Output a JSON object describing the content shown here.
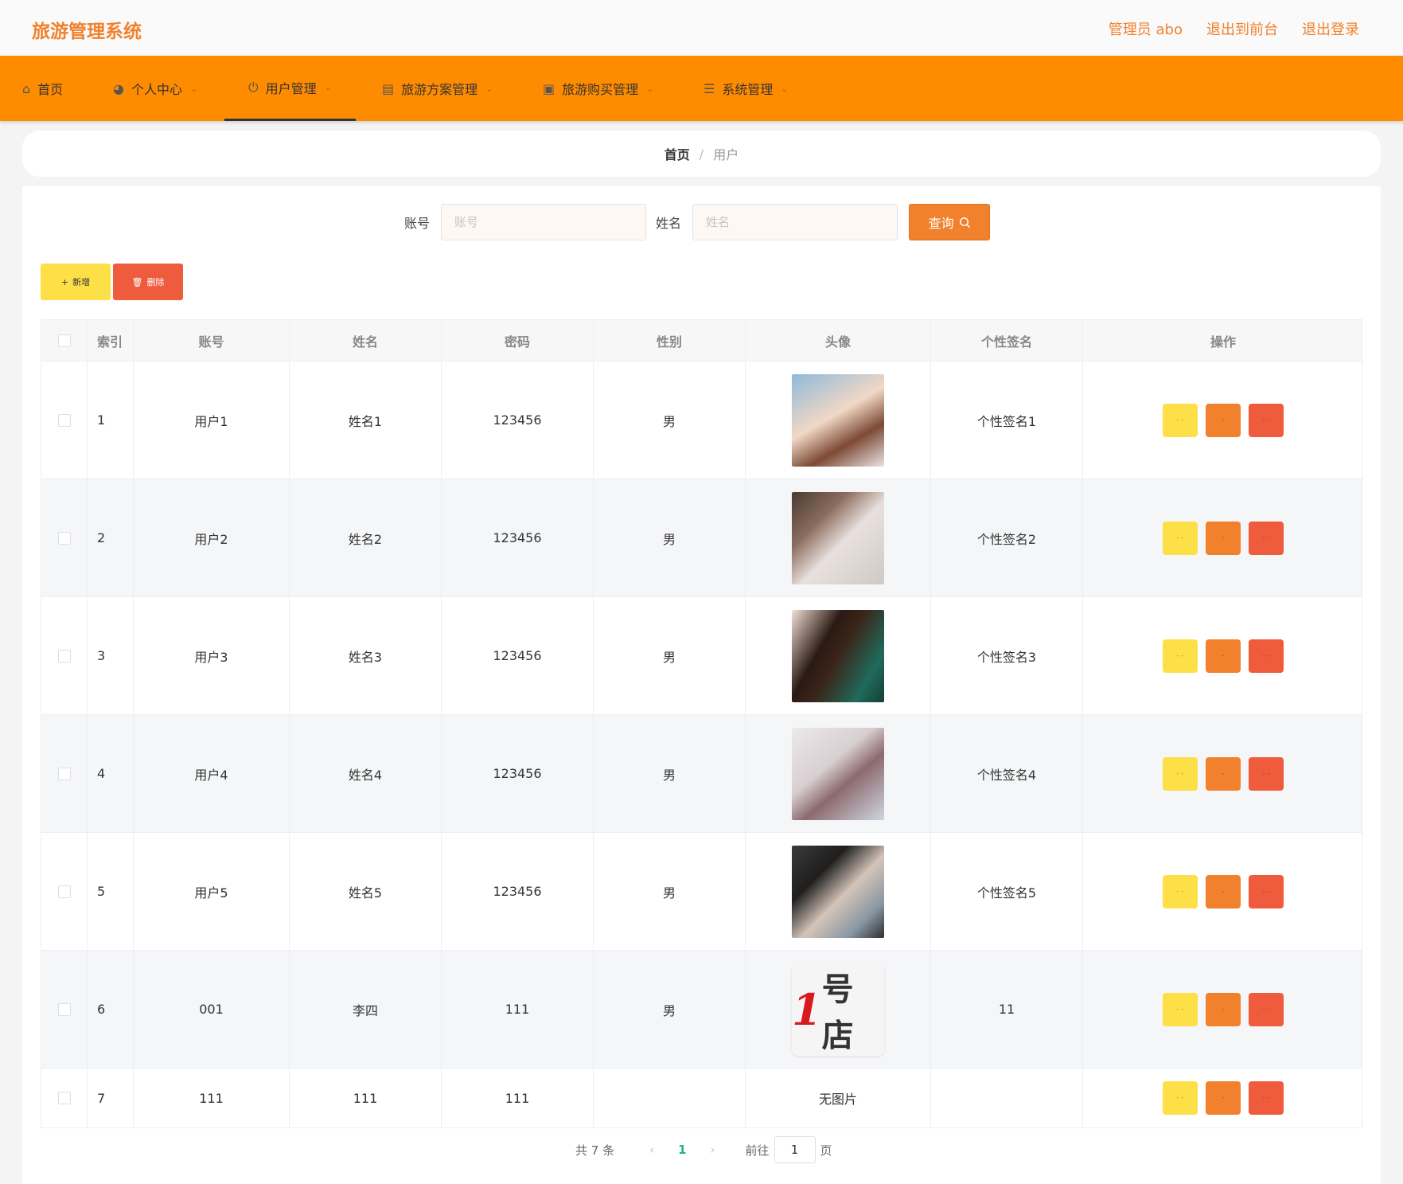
{
  "header": {
    "app_title": "旅游管理系统",
    "admin_label": "管理员 abo",
    "back_to_front": "退出到前台",
    "logout": "退出登录"
  },
  "nav": {
    "items": [
      {
        "label": "首页",
        "icon": "home-icon"
      },
      {
        "label": "个人中心",
        "icon": "user-icon"
      },
      {
        "label": "用户管理",
        "icon": "power-icon"
      },
      {
        "label": "旅游方案管理",
        "icon": "clipboard-icon"
      },
      {
        "label": "旅游购买管理",
        "icon": "briefcase-icon"
      },
      {
        "label": "系统管理",
        "icon": "sliders-icon"
      }
    ],
    "active_index": 2
  },
  "breadcrumb": {
    "home": "首页",
    "separator": "/",
    "current": "用户"
  },
  "search": {
    "account_label": "账号",
    "account_placeholder": "账号",
    "account_value": "",
    "name_label": "姓名",
    "name_placeholder": "姓名",
    "name_value": "",
    "query_button": "查询"
  },
  "actions": {
    "add": "新增",
    "delete": "删除"
  },
  "table": {
    "headers": {
      "index": "索引",
      "account": "账号",
      "name": "姓名",
      "password": "密码",
      "gender": "性别",
      "avatar": "头像",
      "signature": "个性签名",
      "ops": "操作"
    },
    "rows": [
      {
        "index": "1",
        "account": "用户1",
        "name": "姓名1",
        "password": "123456",
        "gender": "男",
        "signature": "个性签名1"
      },
      {
        "index": "2",
        "account": "用户2",
        "name": "姓名2",
        "password": "123456",
        "gender": "男",
        "signature": "个性签名2"
      },
      {
        "index": "3",
        "account": "用户3",
        "name": "姓名3",
        "password": "123456",
        "gender": "男",
        "signature": "个性签名3"
      },
      {
        "index": "4",
        "account": "用户4",
        "name": "姓名4",
        "password": "123456",
        "gender": "男",
        "signature": "个性签名4"
      },
      {
        "index": "5",
        "account": "用户5",
        "name": "姓名5",
        "password": "123456",
        "gender": "男",
        "signature": "个性签名5"
      },
      {
        "index": "6",
        "account": "001",
        "name": "李四",
        "password": "111",
        "gender": "男",
        "signature": "11",
        "avatar_text": "1号店"
      },
      {
        "index": "7",
        "account": "111",
        "name": "111",
        "password": "111",
        "gender": "",
        "signature": "",
        "avatar_text": "无图片"
      }
    ]
  },
  "pagination": {
    "total": "共 7 条",
    "current": "1",
    "goto_label": "前往",
    "page_value": "1",
    "page_suffix": "页"
  },
  "colors": {
    "brand": "#f1812c",
    "nav_bg": "#ff8c00",
    "add": "#fde047",
    "delete": "#ef5b3d",
    "pager_active": "#1bb77f"
  }
}
